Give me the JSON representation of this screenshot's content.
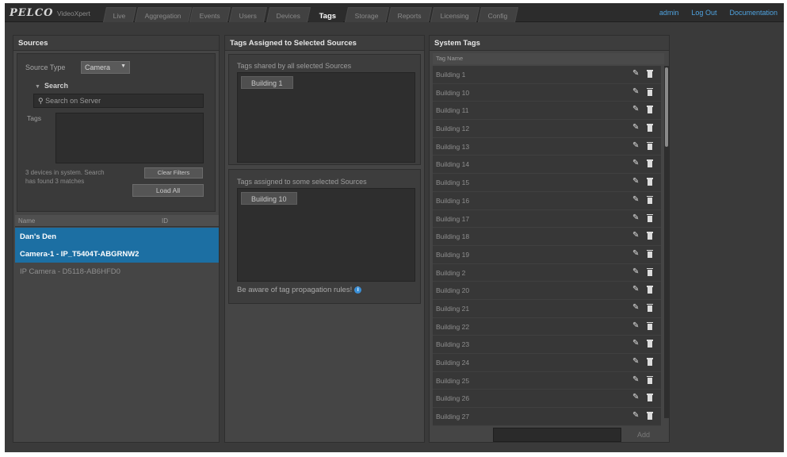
{
  "brand": {
    "logo": "PELCO",
    "product": "VideoXpert"
  },
  "nav": {
    "tabs": [
      {
        "label": "Live"
      },
      {
        "label": "Aggregation"
      },
      {
        "label": "Events"
      },
      {
        "label": "Users"
      },
      {
        "label": "Devices"
      },
      {
        "label": "Tags",
        "active": true
      },
      {
        "label": "Storage"
      },
      {
        "label": "Reports"
      },
      {
        "label": "Licensing"
      },
      {
        "label": "Config"
      }
    ],
    "links": {
      "admin": "admin",
      "logout": "Log Out",
      "docs": "Documentation"
    }
  },
  "sources": {
    "title": "Sources",
    "source_type_label": "Source Type",
    "source_type_value": "Camera",
    "search_toggle": "Search",
    "search_placeholder": "Search on Server",
    "tags_label": "Tags",
    "info_text": "3 devices in system. Search has found 3 matches",
    "clear_filters": "Clear Filters",
    "load_all": "Load All",
    "table": {
      "col_name": "Name",
      "col_id": "ID",
      "rows": [
        {
          "name": "Dan's Den",
          "selected": true
        },
        {
          "name": "Camera-1 - IP_T5404T-ABGRNW2",
          "selected": true
        },
        {
          "name": "IP Camera - D5118-AB6HFD0",
          "selected": false
        }
      ]
    }
  },
  "assigned": {
    "title": "Tags Assigned to Selected Sources",
    "shared_title": "Tags shared by all selected Sources",
    "shared_tags": [
      "Building 1"
    ],
    "some_title": "Tags assigned to some selected Sources",
    "some_tags": [
      "Building 10"
    ],
    "propagation_note": "Be aware of tag propagation rules!"
  },
  "system_tags": {
    "title": "System Tags",
    "col_header": "Tag Name",
    "tags": [
      "Building 1",
      "Building 10",
      "Building 11",
      "Building 12",
      "Building 13",
      "Building 14",
      "Building 15",
      "Building 16",
      "Building 17",
      "Building 18",
      "Building 19",
      "Building 2",
      "Building 20",
      "Building 21",
      "Building 22",
      "Building 23",
      "Building 24",
      "Building 25",
      "Building 26",
      "Building 27"
    ],
    "add_label": "Add"
  },
  "colors": {
    "selected_row": "#1c6fa3",
    "link": "#4fa3e0",
    "info_icon": "#3a8fd6"
  }
}
